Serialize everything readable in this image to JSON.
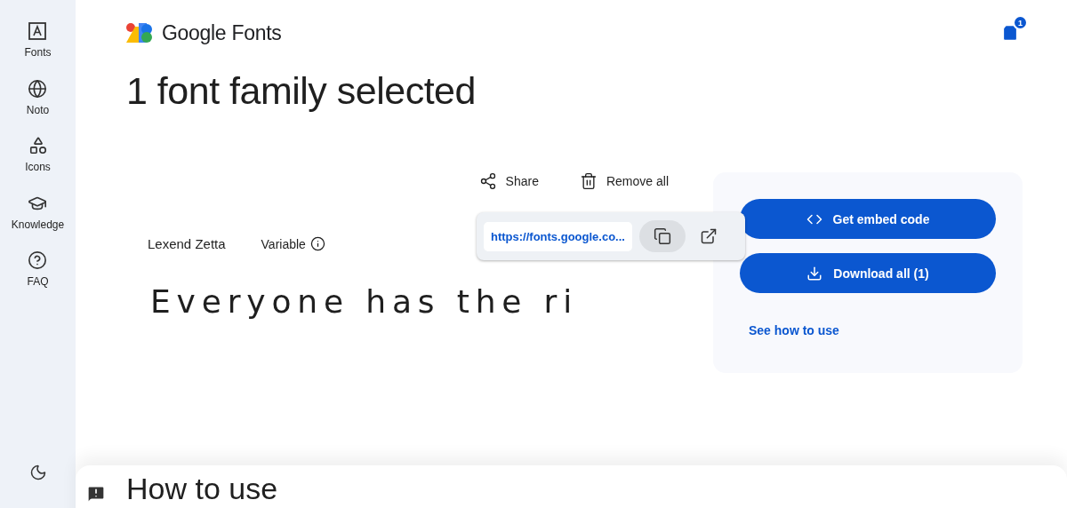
{
  "sidebar": {
    "items": [
      {
        "kind": "fonts",
        "label": "Fonts"
      },
      {
        "kind": "noto",
        "label": "Noto"
      },
      {
        "kind": "icons",
        "label": "Icons"
      },
      {
        "kind": "knowledge",
        "label": "Knowledge"
      },
      {
        "kind": "faq",
        "label": "FAQ"
      }
    ]
  },
  "header": {
    "logo_text": "Google Fonts",
    "cart_count": "1"
  },
  "title": "1 font family selected",
  "actions": [
    {
      "kind": "share",
      "label": "Share"
    },
    {
      "kind": "remove",
      "label": "Remove all"
    }
  ],
  "share_popup": {
    "url": "https://fonts.google.co..."
  },
  "font": {
    "name": "Lexend Zetta",
    "type": "Variable",
    "sample": "Everyone has the ri"
  },
  "panel": {
    "buttons": [
      {
        "kind": "embed",
        "label": "Get embed code"
      },
      {
        "kind": "download",
        "label": "Download all (1)"
      }
    ],
    "link": "See how to use"
  },
  "section_title": "How to use"
}
